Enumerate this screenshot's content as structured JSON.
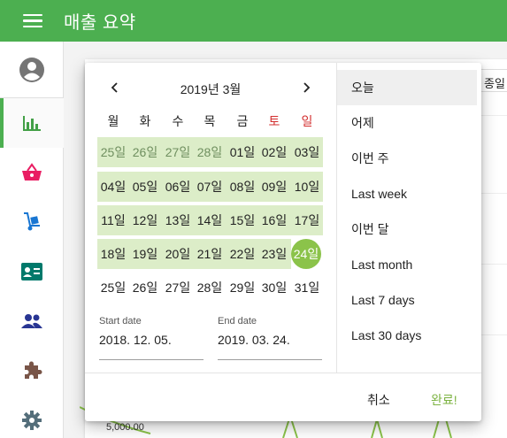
{
  "app": {
    "title": "매출 요약"
  },
  "background": {
    "cell_text": "종일",
    "axis_tick": "5,000.00"
  },
  "calendar": {
    "month_label": "2019년 3월",
    "weekdays": [
      "월",
      "화",
      "수",
      "목",
      "금",
      "토",
      "일"
    ],
    "weeks": [
      [
        "25일",
        "26일",
        "27일",
        "28일",
        "01일",
        "02일",
        "03일"
      ],
      [
        "04일",
        "05일",
        "06일",
        "07일",
        "08일",
        "09일",
        "10일"
      ],
      [
        "11일",
        "12일",
        "13일",
        "14일",
        "15일",
        "16일",
        "17일"
      ],
      [
        "18일",
        "19일",
        "20일",
        "21일",
        "22일",
        "23일",
        "24일"
      ],
      [
        "25일",
        "26일",
        "27일",
        "28일",
        "29일",
        "30일",
        "31일"
      ]
    ]
  },
  "range": {
    "start_label": "Start date",
    "start_value": "2018. 12. 05.",
    "end_label": "End date",
    "end_value": "2019. 03. 24."
  },
  "presets": [
    "오늘",
    "어제",
    "이번 주",
    "Last week",
    "이번 달",
    "Last month",
    "Last 7 days",
    "Last 30 days"
  ],
  "actions": {
    "cancel": "취소",
    "done": "완료!"
  },
  "colors": {
    "primary": "#4caf50",
    "range": "#dcedc8",
    "selected": "#8bc34a",
    "weekend": "#d32f2f"
  }
}
